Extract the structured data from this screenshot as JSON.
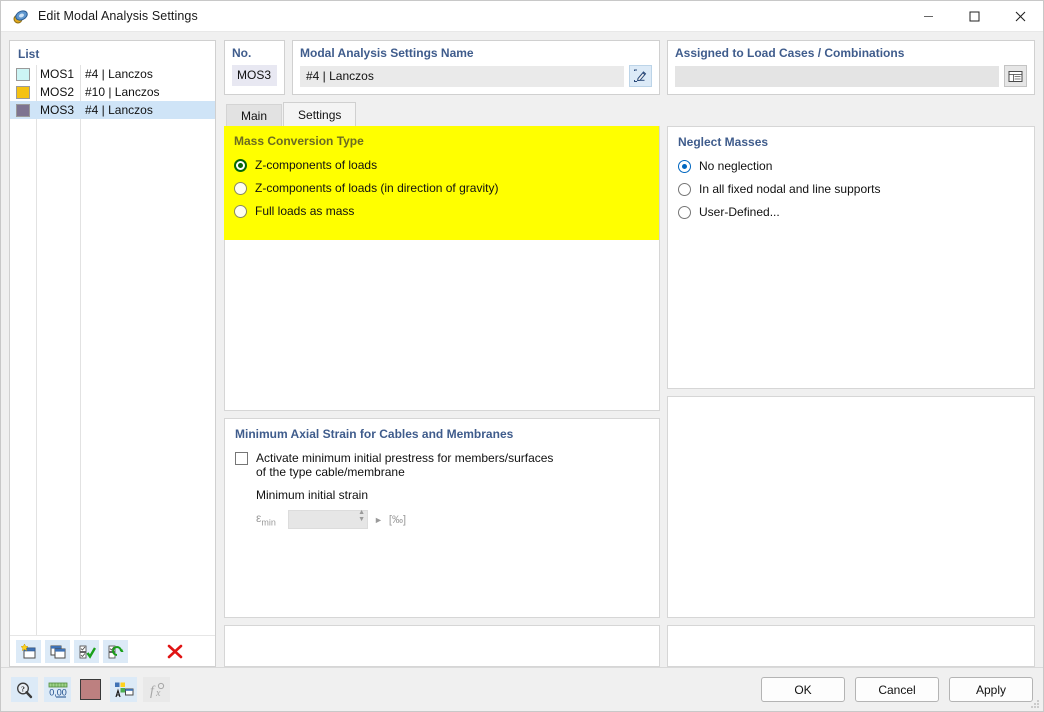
{
  "window": {
    "title": "Edit Modal Analysis Settings",
    "app_icon": "modal-analysis-icon",
    "minimize": "—",
    "maximize": "☐",
    "close": "✕"
  },
  "list_panel": {
    "caption": "List",
    "rows": [
      {
        "color": "#ccf5f5",
        "id": "MOS1",
        "desc": "#4 | Lanczos",
        "selected": false
      },
      {
        "color": "#f5c211",
        "id": "MOS2",
        "desc": "#10 | Lanczos",
        "selected": false
      },
      {
        "color": "#7e7491",
        "id": "MOS3",
        "desc": "#4 | Lanczos",
        "selected": true
      }
    ],
    "toolbar": [
      {
        "name": "new-button",
        "title": "New"
      },
      {
        "name": "copy-button",
        "title": "Copy"
      },
      {
        "name": "select-all-button",
        "title": "Select All"
      },
      {
        "name": "invert-selection-button",
        "title": "Invert Selection"
      },
      {
        "name": "delete-button",
        "title": "Delete"
      }
    ]
  },
  "header": {
    "no_label": "No.",
    "no_value": "MOS3",
    "name_label": "Modal Analysis Settings Name",
    "name_value": "#4 | Lanczos",
    "name_placeholder": "",
    "edit_icon": "pencil-edit-icon",
    "assigned_label": "Assigned to Load Cases / Combinations",
    "assigned_value": "",
    "assigned_placeholder": "",
    "assigned_icon": "table-select-icon"
  },
  "tabs": [
    {
      "label": "Main",
      "active": false
    },
    {
      "label": "Settings",
      "active": true
    }
  ],
  "mass_conversion": {
    "title": "Mass Conversion Type",
    "highlight_color": "#ffff00",
    "selected_index": 0,
    "options": [
      "Z-components of loads",
      "Z-components of loads (in direction of gravity)",
      "Full loads as mass"
    ]
  },
  "neglect_masses": {
    "title": "Neglect Masses",
    "selected_index": 0,
    "options": [
      "No neglection",
      "In all fixed nodal and line supports",
      "User-Defined..."
    ]
  },
  "min_axial_strain": {
    "title": "Minimum Axial Strain for Cables and Membranes",
    "checkbox_checked": false,
    "checkbox_label_line1": "Activate minimum initial prestress for members/surfaces",
    "checkbox_label_line2": "of the type cable/membrane",
    "sub_label": "Minimum initial strain",
    "eps_symbol": "ε",
    "eps_subscript": "min",
    "eps_value": "",
    "eps_unit": "[‰]",
    "enabled": false
  },
  "footer": {
    "tools": [
      {
        "name": "info-search-icon",
        "disabled": false
      },
      {
        "name": "number-format-icon",
        "label": "0,00",
        "disabled": false
      },
      {
        "name": "color-swatch-icon",
        "color": "#bd8080",
        "disabled": false
      },
      {
        "name": "display-properties-icon",
        "disabled": false
      },
      {
        "name": "formula-fx-icon",
        "disabled": true
      }
    ],
    "buttons": [
      {
        "label": "OK",
        "name": "ok-button"
      },
      {
        "label": "Cancel",
        "name": "cancel-button"
      },
      {
        "label": "Apply",
        "name": "apply-button"
      }
    ]
  }
}
